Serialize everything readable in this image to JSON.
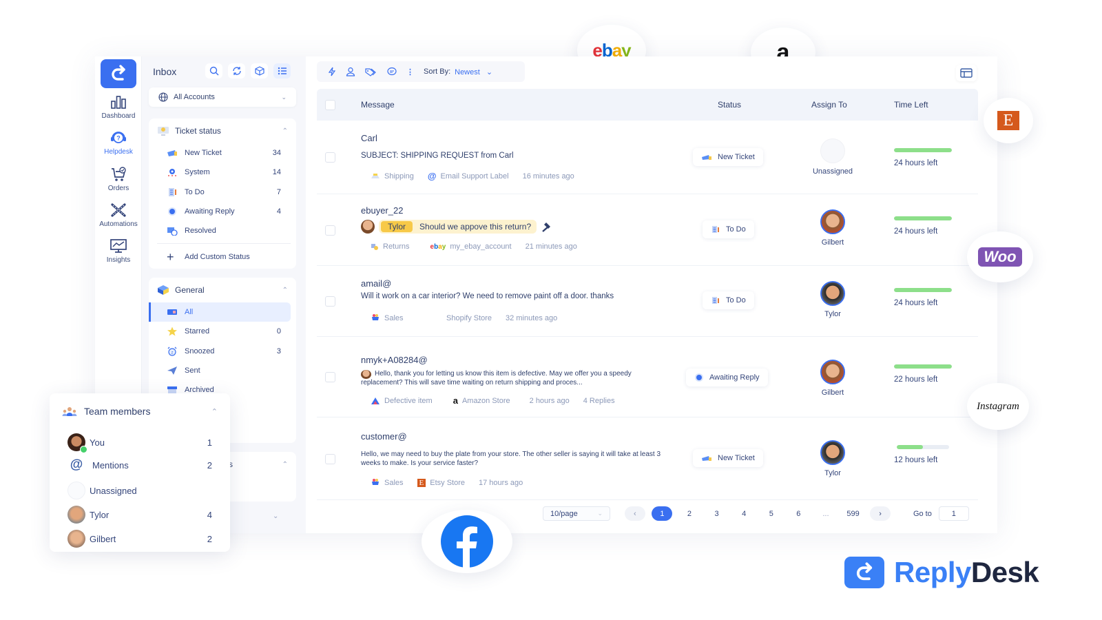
{
  "rail": {
    "items": [
      {
        "label": "Dashboard",
        "icon": "bar-chart-icon"
      },
      {
        "label": "Helpdesk",
        "icon": "headset-icon",
        "active": true
      },
      {
        "label": "Orders",
        "icon": "cart-icon"
      },
      {
        "label": "Automations",
        "icon": "tools-icon"
      },
      {
        "label": "Insights",
        "icon": "monitor-chart-icon"
      }
    ]
  },
  "panel": {
    "title": "Inbox",
    "accounts": "All Accounts",
    "ticket_status": {
      "title": "Ticket status",
      "items": [
        {
          "label": "New Ticket",
          "count": "34"
        },
        {
          "label": "System",
          "count": "14"
        },
        {
          "label": "To Do",
          "count": "7"
        },
        {
          "label": "Awaiting Reply",
          "count": "4"
        },
        {
          "label": "Resolved",
          "count": ""
        }
      ],
      "add_label": "Add Custom Status"
    },
    "general": {
      "title": "General",
      "items": [
        {
          "label": "All",
          "count": "",
          "active": true
        },
        {
          "label": "Starred",
          "count": "0"
        },
        {
          "label": "Snoozed",
          "count": "3"
        },
        {
          "label": "Sent",
          "count": ""
        },
        {
          "label": "Archived",
          "count": ""
        }
      ]
    },
    "hidden_section_fragment": "rs"
  },
  "toolbar": {
    "sort_label": "Sort By:",
    "sort_value": "Newest"
  },
  "table": {
    "headers": {
      "message": "Message",
      "status": "Status",
      "assign": "Assign To",
      "time": "Time Left"
    },
    "rows": [
      {
        "sender": "Carl",
        "message": "SUBJECT: SHIPPING REQUEST from Carl",
        "meta": [
          "Shipping",
          "Email Support Label",
          "16 minutes ago"
        ],
        "status": "New Ticket",
        "assignee": "Unassigned",
        "time_left": "24 hours left",
        "progress": 1.0
      },
      {
        "sender": "ebuyer_22",
        "mention_user": "Tylor",
        "message": "Should we appove this return?",
        "meta": [
          "Returns",
          "my_ebay_account",
          "21 minutes ago"
        ],
        "status": "To Do",
        "assignee": "Gilbert",
        "time_left": "24 hours left",
        "progress": 1.0
      },
      {
        "sender": "amail@",
        "message": "Will it work on a car interior? We need to remove paint off a door. thanks",
        "meta": [
          "Sales",
          "Shopify Store",
          "32 minutes ago"
        ],
        "status": "To Do",
        "assignee": "Tylor",
        "time_left": "24 hours left",
        "progress": 1.0
      },
      {
        "sender": "nmyk+A08284@",
        "message": "Hello, thank you for letting us know this item is defective. May we offer you a speedy replacement? This will save time waiting on return shipping and proces...",
        "meta": [
          "Defective item",
          "Amazon Store",
          "2 hours ago",
          "4 Replies"
        ],
        "status": "Awaiting Reply",
        "assignee": "Gilbert",
        "time_left": "22 hours left",
        "progress": 1.0
      },
      {
        "sender": "customer@",
        "message": "Hello, we may need to buy the plate from your store. The other seller is saying it will take at least 3 weeks to make. Is your service faster?",
        "meta": [
          "Sales",
          "Etsy Store",
          "17 hours ago"
        ],
        "status": "New Ticket",
        "assignee": "Tylor",
        "time_left": "12 hours left",
        "progress": 0.5
      }
    ]
  },
  "pagination": {
    "per_page": "10/page",
    "pages": [
      "1",
      "2",
      "3",
      "4",
      "5",
      "6",
      "...",
      "599"
    ],
    "current": "1",
    "goto_label": "Go to",
    "goto_value": "1"
  },
  "team": {
    "title": "Team members",
    "items": [
      {
        "label": "You",
        "count": "1"
      },
      {
        "label": "Mentions",
        "count": "2"
      },
      {
        "label": "Unassigned",
        "count": ""
      },
      {
        "label": "Tylor",
        "count": "4"
      },
      {
        "label": "Gilbert",
        "count": "2"
      }
    ]
  },
  "integrations": {
    "ebay": "ebay",
    "amazon": "a",
    "etsy": "E",
    "woo": "Woo",
    "instagram": "Instagram",
    "facebook": "f"
  },
  "brand": {
    "part1": "Reply",
    "part2": "Desk"
  },
  "colors": {
    "accent": "#3a6ff0",
    "progress": "#8ddf8a",
    "mention": "#fdf2cf",
    "mention_tag": "#f7c948"
  }
}
